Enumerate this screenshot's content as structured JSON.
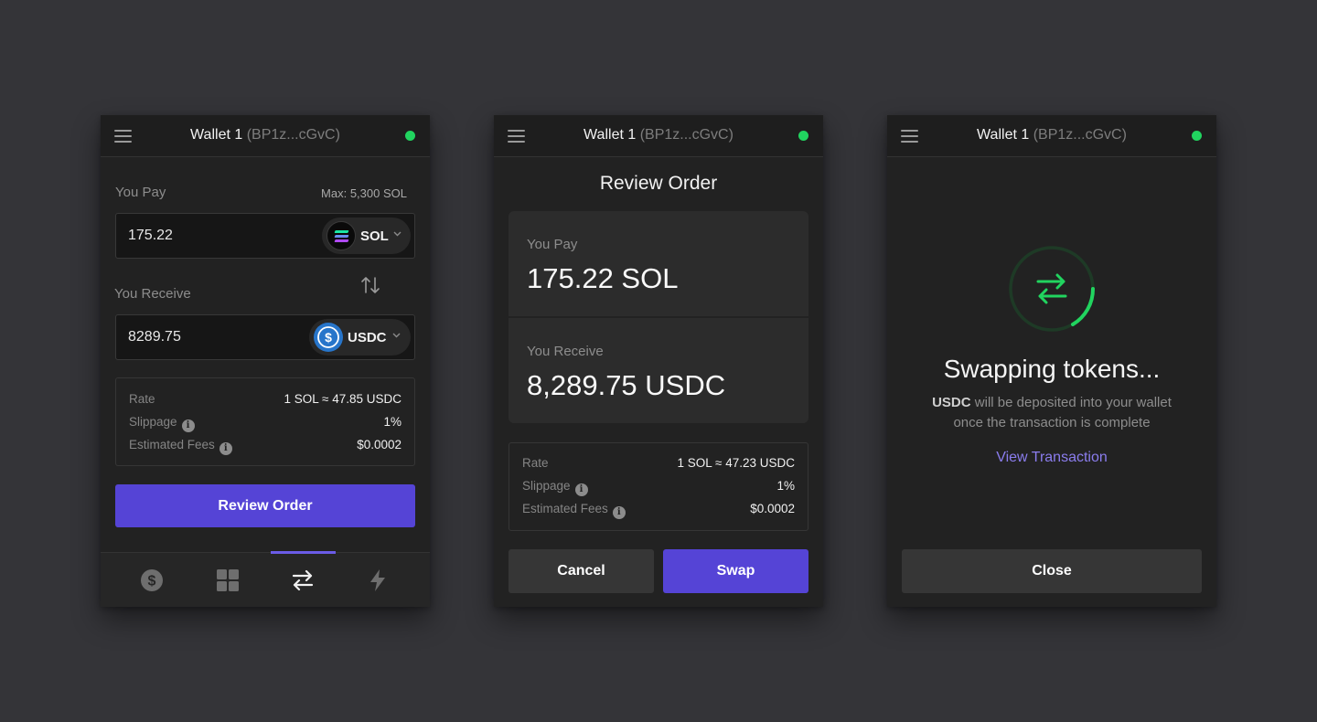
{
  "header": {
    "wallet_name": "Wallet 1",
    "wallet_address": "(BP1z...cGvC)",
    "status": "connected",
    "status_color": "#21d45f"
  },
  "swap_form": {
    "you_pay_label": "You Pay",
    "max_label": "Max: 5,300 SOL",
    "pay_amount": "175.22",
    "pay_token": "SOL",
    "you_receive_label": "You Receive",
    "receive_amount": "8289.75",
    "receive_token": "USDC",
    "rate_label": "Rate",
    "rate_value": "1 SOL ≈ 47.85 USDC",
    "slippage_label": "Slippage",
    "slippage_value": "1%",
    "fees_label": "Estimated Fees",
    "fees_value": "$0.0002",
    "review_button": "Review Order"
  },
  "tabs": [
    {
      "icon": "dollar-icon",
      "active": false
    },
    {
      "icon": "grid-icon",
      "active": false
    },
    {
      "icon": "swap-icon",
      "active": true
    },
    {
      "icon": "lightning-icon",
      "active": false
    }
  ],
  "review": {
    "title": "Review Order",
    "pay_label": "You Pay",
    "pay_amount": "175.22 SOL",
    "receive_label": "You Receive",
    "receive_amount": "8,289.75 USDC",
    "rate_label": "Rate",
    "rate_value": "1 SOL ≈ 47.23 USDC",
    "slippage_label": "Slippage",
    "slippage_value": "1%",
    "fees_label": "Estimated Fees",
    "fees_value": "$0.0002",
    "cancel_button": "Cancel",
    "swap_button": "Swap"
  },
  "progress": {
    "title": "Swapping tokens...",
    "token": "USDC",
    "message_line1": "will be deposited into your wallet",
    "message_line2": "once the transaction is complete",
    "view_link": "View Transaction",
    "close_button": "Close"
  },
  "colors": {
    "background": "#343438",
    "panel": "#222222",
    "accent": "#5544d6",
    "link": "#8b7dee",
    "success": "#21d45f"
  }
}
